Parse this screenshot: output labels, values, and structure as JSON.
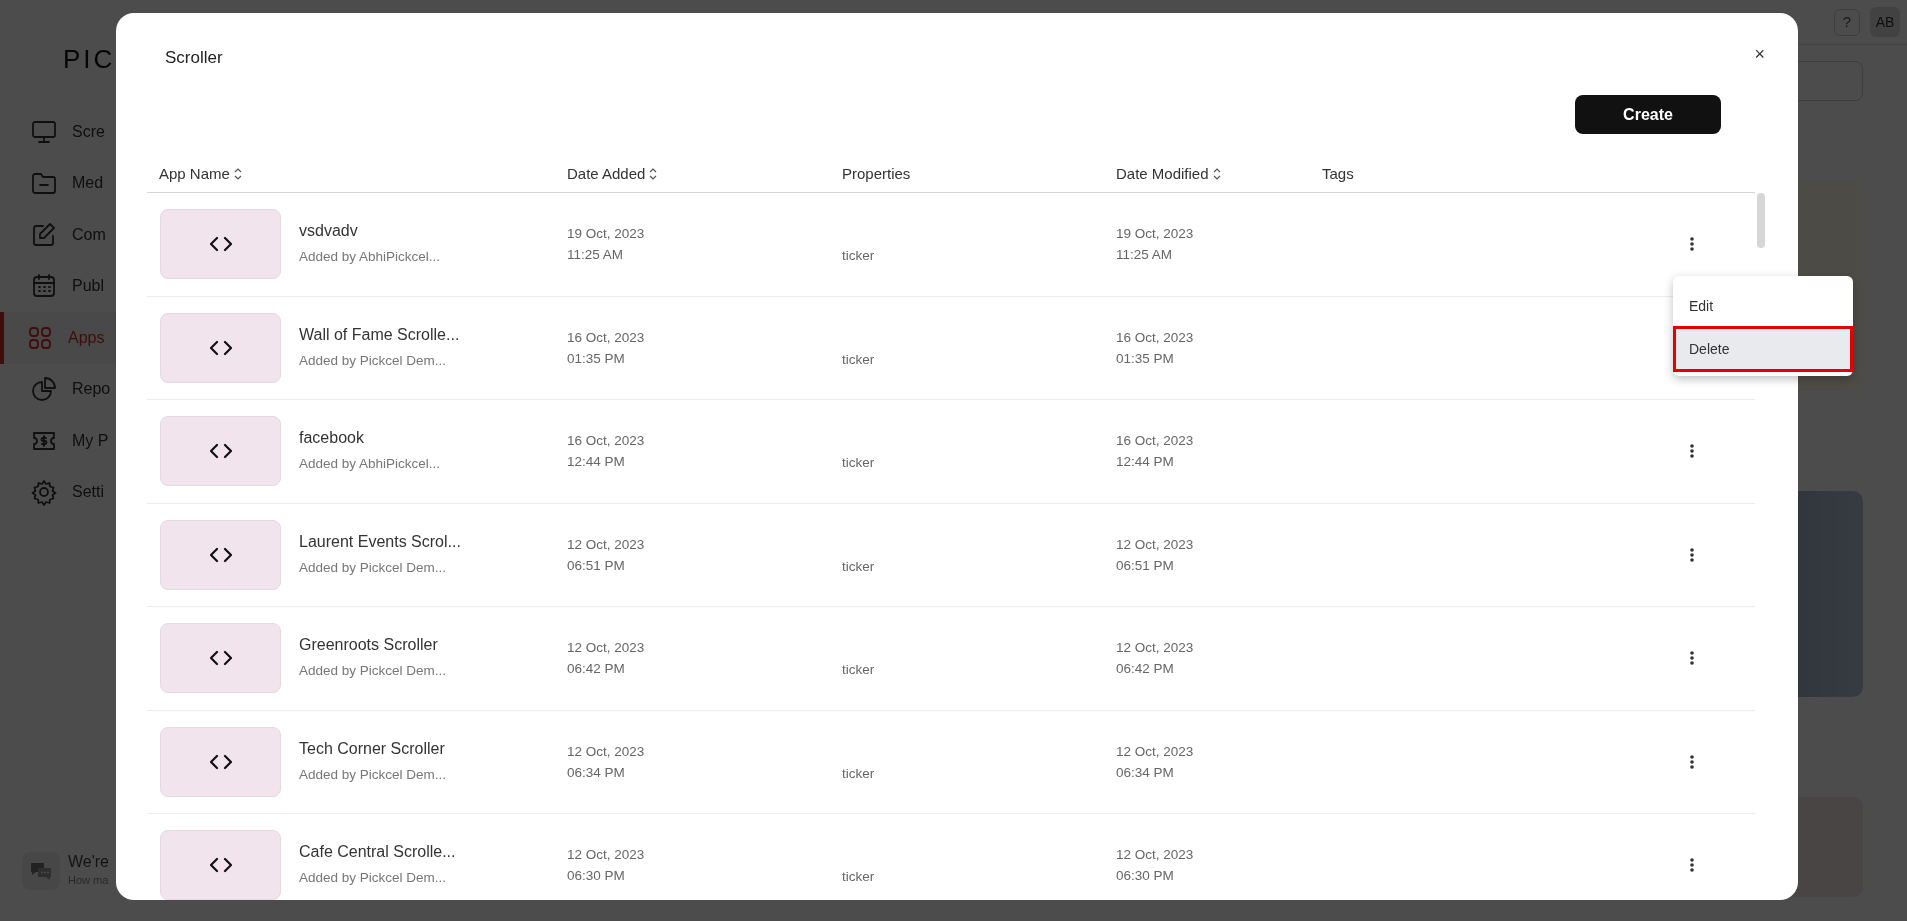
{
  "background": {
    "logo": "PIC",
    "sidebar": {
      "items": [
        {
          "label": "Scre",
          "selected": false
        },
        {
          "label": "Med",
          "selected": false
        },
        {
          "label": "Com",
          "selected": false
        },
        {
          "label": "Publ",
          "selected": false
        },
        {
          "label": "Apps",
          "selected": true
        },
        {
          "label": "Repo",
          "selected": false
        },
        {
          "label": "My P",
          "selected": false
        },
        {
          "label": "Setti",
          "selected": false
        }
      ]
    },
    "header": {
      "help": "?",
      "avatar": "AB"
    },
    "chat": {
      "title": "We're",
      "subtitle": "How ma"
    }
  },
  "modal": {
    "title": "Scroller",
    "close": "×",
    "create_button": "Create",
    "table": {
      "columns": [
        {
          "label": "App Name",
          "sortable": true
        },
        {
          "label": "Date Added",
          "sortable": true
        },
        {
          "label": "Properties",
          "sortable": false
        },
        {
          "label": "Date Modified",
          "sortable": true
        },
        {
          "label": "Tags",
          "sortable": false
        }
      ],
      "rows": [
        {
          "name": "vsdvadv",
          "added_by": "Added by AbhiPickcel...",
          "date_added": "19 Oct, 2023",
          "time_added": "11:25 AM",
          "properties": "ticker",
          "date_modified": "19 Oct, 2023",
          "time_modified": "11:25 AM",
          "menu_open": true
        },
        {
          "name": "Wall of Fame Scrolle...",
          "added_by": "Added by Pickcel Dem...",
          "date_added": "16 Oct, 2023",
          "time_added": "01:35 PM",
          "properties": "ticker",
          "date_modified": "16 Oct, 2023",
          "time_modified": "01:35 PM",
          "menu_open": false
        },
        {
          "name": "facebook",
          "added_by": "Added by AbhiPickcel...",
          "date_added": "16 Oct, 2023",
          "time_added": "12:44 PM",
          "properties": "ticker",
          "date_modified": "16 Oct, 2023",
          "time_modified": "12:44 PM",
          "menu_open": false
        },
        {
          "name": "Laurent Events Scrol...",
          "added_by": "Added by Pickcel Dem...",
          "date_added": "12 Oct, 2023",
          "time_added": "06:51 PM",
          "properties": "ticker",
          "date_modified": "12 Oct, 2023",
          "time_modified": "06:51 PM",
          "menu_open": false
        },
        {
          "name": "Greenroots Scroller",
          "added_by": "Added by Pickcel Dem...",
          "date_added": "12 Oct, 2023",
          "time_added": "06:42 PM",
          "properties": "ticker",
          "date_modified": "12 Oct, 2023",
          "time_modified": "06:42 PM",
          "menu_open": false
        },
        {
          "name": "Tech Corner Scroller",
          "added_by": "Added by Pickcel Dem...",
          "date_added": "12 Oct, 2023",
          "time_added": "06:34 PM",
          "properties": "ticker",
          "date_modified": "12 Oct, 2023",
          "time_modified": "06:34 PM",
          "menu_open": false
        },
        {
          "name": "Cafe Central Scrolle...",
          "added_by": "Added by Pickcel Dem...",
          "date_added": "12 Oct, 2023",
          "time_added": "06:30 PM",
          "properties": "ticker",
          "date_modified": "12 Oct, 2023",
          "time_modified": "06:30 PM",
          "menu_open": false
        }
      ]
    },
    "menu": {
      "items": [
        {
          "label": "Edit",
          "highlighted": false
        },
        {
          "label": "Delete",
          "highlighted": true
        }
      ]
    }
  }
}
